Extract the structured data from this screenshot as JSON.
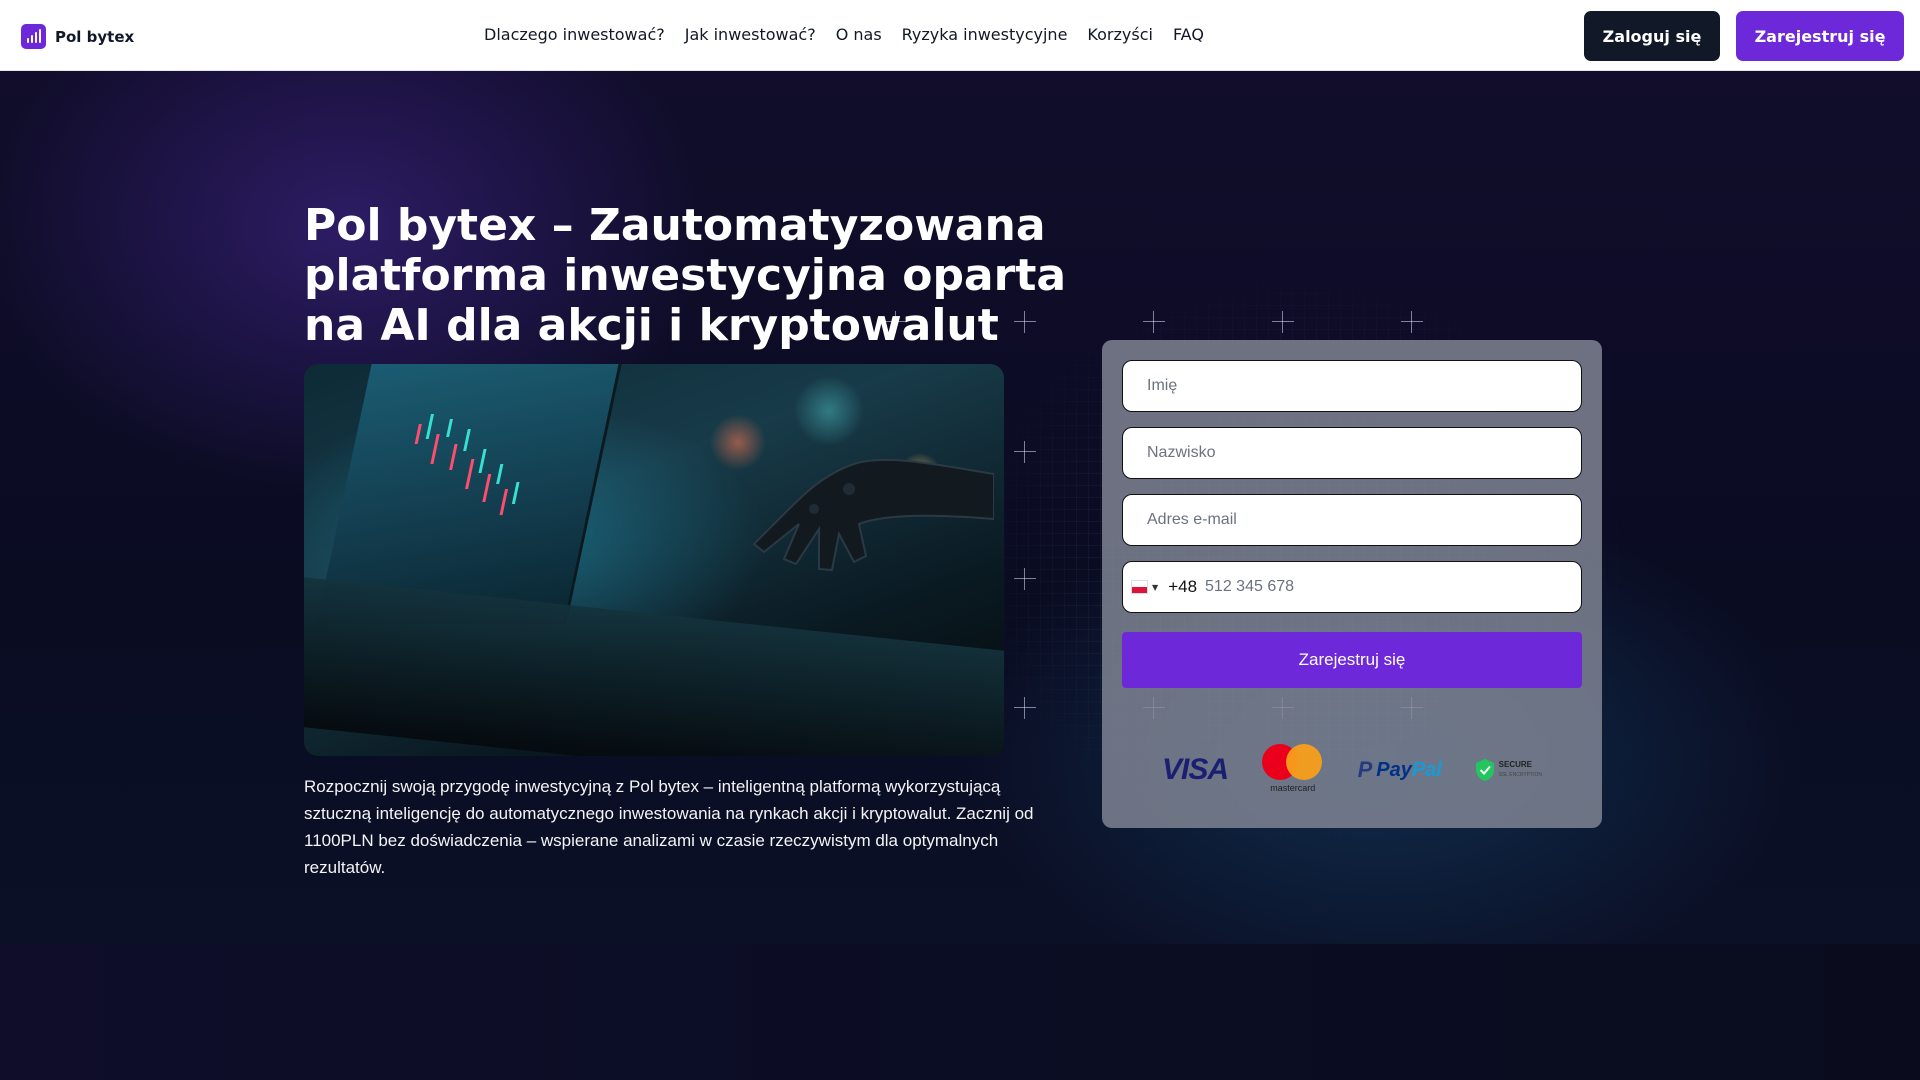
{
  "brand": {
    "name": "Pol bytex",
    "accent": "#6d28d9"
  },
  "nav": {
    "items": [
      "Dlaczego inwestować?",
      "Jak inwestować?",
      "O nas",
      "Ryzyka inwestycyjne",
      "Korzyści",
      "FAQ"
    ]
  },
  "header": {
    "login_label": "Zaloguj się",
    "register_label": "Zarejestruj się"
  },
  "hero": {
    "title": "Pol bytex – Zautomatyzowana platforma inwestycyjna oparta na AI dla akcji i kryptowalut",
    "description": "Rozpocznij swoją przygodę inwestycyjną z Pol bytex – inteligentną platformą wykorzystującą sztuczną inteligencję do automatycznego inwestowania na rynkach akcji i kryptowalut. Zacznij od 1100PLN bez doświadczenia – wspierane analizami w czasie rzeczywistym dla optymalnych rezultatów."
  },
  "form": {
    "first_name_placeholder": "Imię",
    "last_name_placeholder": "Nazwisko",
    "email_placeholder": "Adres e-mail",
    "dial_code": "+48",
    "phone_placeholder": "512 345 678",
    "submit_label": "Zarejestruj się"
  },
  "payments": {
    "visa": "VISA",
    "mastercard": "mastercard",
    "paypal_pay": "Pay",
    "paypal_pal": "Pal",
    "secure": "SECURE",
    "secure_sub": "SSL ENCRYPTION"
  }
}
